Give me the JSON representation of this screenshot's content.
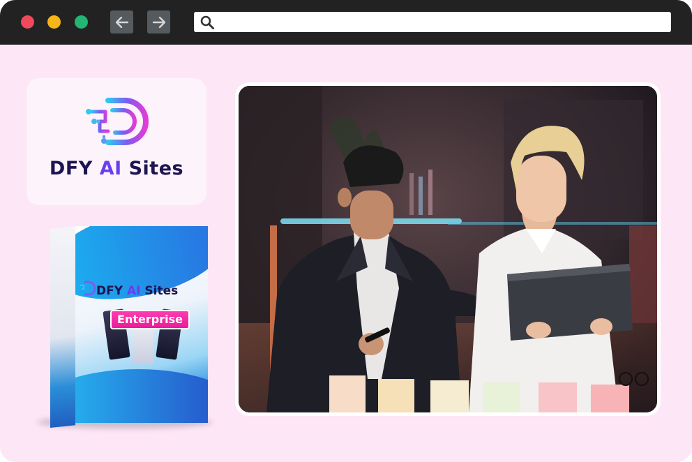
{
  "browser": {
    "address": {
      "value": "",
      "placeholder": ""
    },
    "icons": {
      "back": "arrow-left-icon",
      "forward": "arrow-right-icon",
      "search": "search-icon"
    },
    "window_dot_colors": [
      "#ef4a5c",
      "#f7b617",
      "#22b573"
    ]
  },
  "logo": {
    "word1": "DFY",
    "word2": "AI",
    "word3": "Sites",
    "colors": {
      "dark": "#1d1450",
      "accent": "#6a3df0",
      "gradient_start": "#33c6f0",
      "gradient_end": "#e23cd8"
    }
  },
  "product_box": {
    "brand_word1": "DFY",
    "brand_word2": "AI",
    "brand_word3": "Sites",
    "edition": "Enterprise",
    "edition_color": "#e61a97"
  },
  "photo": {
    "description_icon": "business-meeting-photo"
  },
  "colors": {
    "background": "#fde6f6",
    "titlebar": "#222222"
  }
}
